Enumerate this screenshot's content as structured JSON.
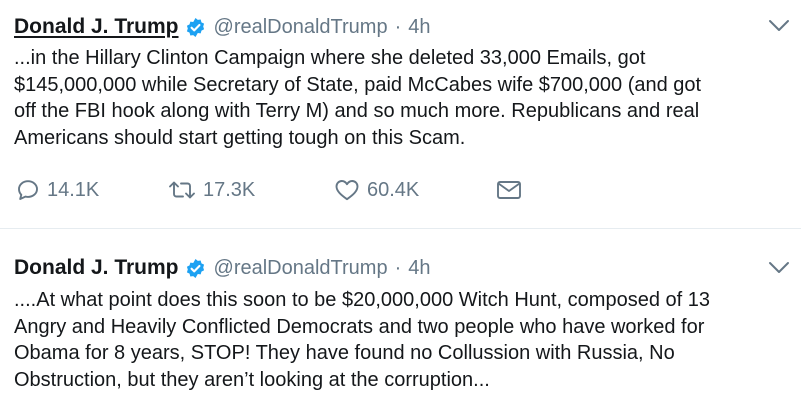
{
  "tweets": [
    {
      "author": {
        "name": "Donald J. Trump",
        "handle": "@realDonaldTrump"
      },
      "separator": "·",
      "time": "4h",
      "text_lines": [
        "...in the Hillary Clinton Campaign where she deleted 33,000 Emails, got",
        "$145,000,000 while Secretary of State, paid McCabes wife $700,000 (and got",
        "off the FBI hook along with Terry M) and so much more. Republicans and real",
        "Americans should start getting tough on this Scam."
      ],
      "actions": {
        "replies": "14.1K",
        "retweets": "17.3K",
        "likes": "60.4K"
      }
    },
    {
      "author": {
        "name": "Donald J. Trump",
        "handle": "@realDonaldTrump"
      },
      "separator": "·",
      "time": "4h",
      "text_lines": [
        "....At what point does this soon to be $20,000,000 Witch Hunt, composed of 13",
        "Angry and Heavily Conflicted Democrats and two people who have worked for",
        "Obama for 8 years, STOP! They have found no Collussion with Russia, No",
        "Obstruction, but they aren’t looking at the corruption..."
      ]
    }
  ],
  "colors": {
    "text": "#14171a",
    "secondary": "#657786",
    "verified": "#1da1f2",
    "divider": "#e6ecf0"
  },
  "icons": {
    "reply": "reply-icon",
    "retweet": "retweet-icon",
    "like": "heart-icon",
    "message": "envelope-icon",
    "verified": "verified-badge-icon",
    "caret": "chevron-down-icon"
  }
}
